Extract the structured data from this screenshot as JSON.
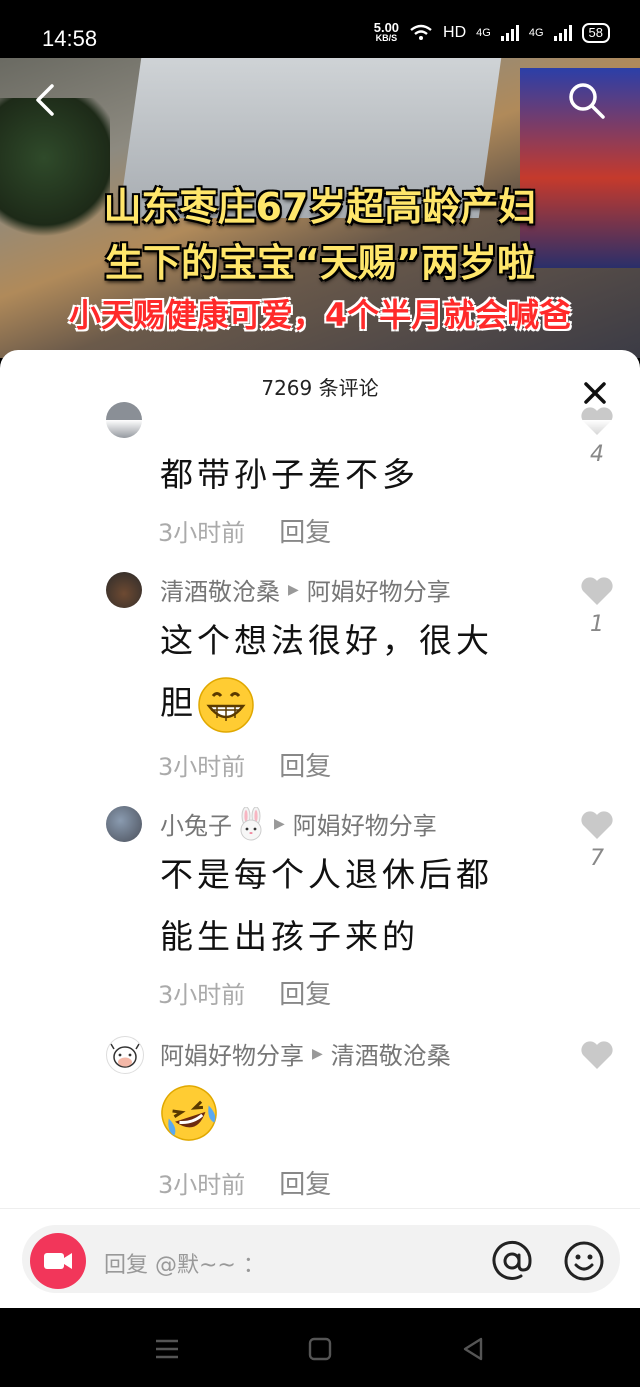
{
  "status_bar": {
    "time": "14:58",
    "speed": "5.00",
    "speed_unit": "KB/S",
    "hd": "HD",
    "net1": "4G",
    "net2": "4G",
    "battery": "58"
  },
  "video": {
    "title_line1": "山东枣庄67岁超高龄产妇",
    "title_line2": "生下的宝宝“天赐”两岁啦",
    "title_line3": "小天赐健康可爱，4个半月就会喊爸"
  },
  "sheet": {
    "count_label": "7269 条评论"
  },
  "comments": [
    {
      "user": "",
      "reply_to": "",
      "text": "都带孙子差不多",
      "time": "3小时前",
      "reply": "回复",
      "likes": "4"
    },
    {
      "user": "清酒敬沧桑",
      "reply_to": "阿娟好物分享",
      "text_line1": "这个想法很好，很大",
      "text_line2": "胆",
      "time": "3小时前",
      "reply": "回复",
      "likes": "1"
    },
    {
      "user": "小兔子",
      "reply_to": "阿娟好物分享",
      "text_line1": "不是每个人退休后都",
      "text_line2": "能生出孩子来的",
      "time": "3小时前",
      "reply": "回复",
      "likes": "7"
    },
    {
      "user": "阿娟好物分享",
      "reply_to": "清酒敬沧桑",
      "time": "3小时前",
      "reply": "回复",
      "likes": ""
    }
  ],
  "input": {
    "placeholder": "回复 @默~~ ："
  },
  "icons": [
    "back-icon",
    "search-icon",
    "close-icon",
    "heart-icon",
    "video-record-icon",
    "at-icon",
    "emoji-icon",
    "menu-icon",
    "home-icon",
    "back-triangle-icon"
  ]
}
